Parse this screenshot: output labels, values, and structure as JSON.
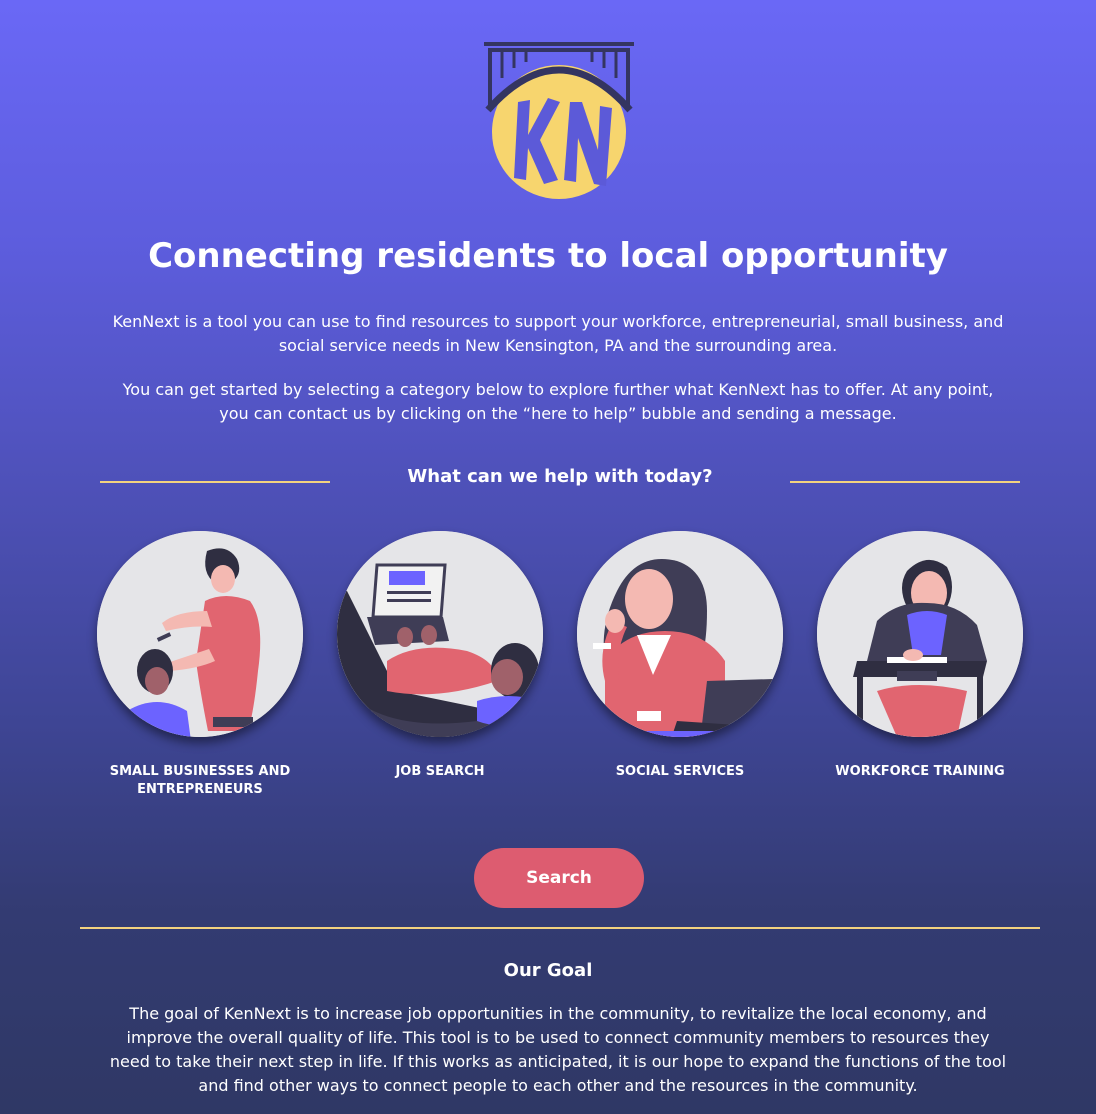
{
  "brand": {
    "logo_text": "KN",
    "colors": {
      "logo_yellow": "#f7d56e",
      "bridge": "#343561",
      "accent_line": "#f3d27f",
      "button": "#dd5c70"
    }
  },
  "hero": {
    "headline": "Connecting residents to local opportunity",
    "intro_1": "KenNext is a tool you can use to find resources to support your workforce, entrepreneurial, small business, and social service needs in New Kensington, PA and the surrounding area.",
    "intro_2": "You can get started by selecting a category below to explore further what KenNext has to offer.  At any point, you can contact us by clicking on the “here to help” bubble and sending a message."
  },
  "categories": {
    "title": "What can we help with today?",
    "items": [
      {
        "label": "SMALL BUSINESSES AND ENTREPRENEURS",
        "icon": "barber-illustration-icon"
      },
      {
        "label": "JOB SEARCH",
        "icon": "laptop-user-illustration-icon"
      },
      {
        "label": "SOCIAL SERVICES",
        "icon": "phone-call-illustration-icon"
      },
      {
        "label": "WORKFORCE TRAINING",
        "icon": "student-desk-illustration-icon"
      }
    ]
  },
  "search": {
    "label": "Search"
  },
  "goal": {
    "title": "Our Goal",
    "text": "The goal of KenNext is to increase job opportunities in the community, to revitalize the local economy, and improve the overall quality of life. This tool is to be used to connect community members to resources they need to take their next step in life. If this works as anticipated, it is our hope to expand the functions of the tool and find other ways to connect people to each other and the resources in the community."
  }
}
